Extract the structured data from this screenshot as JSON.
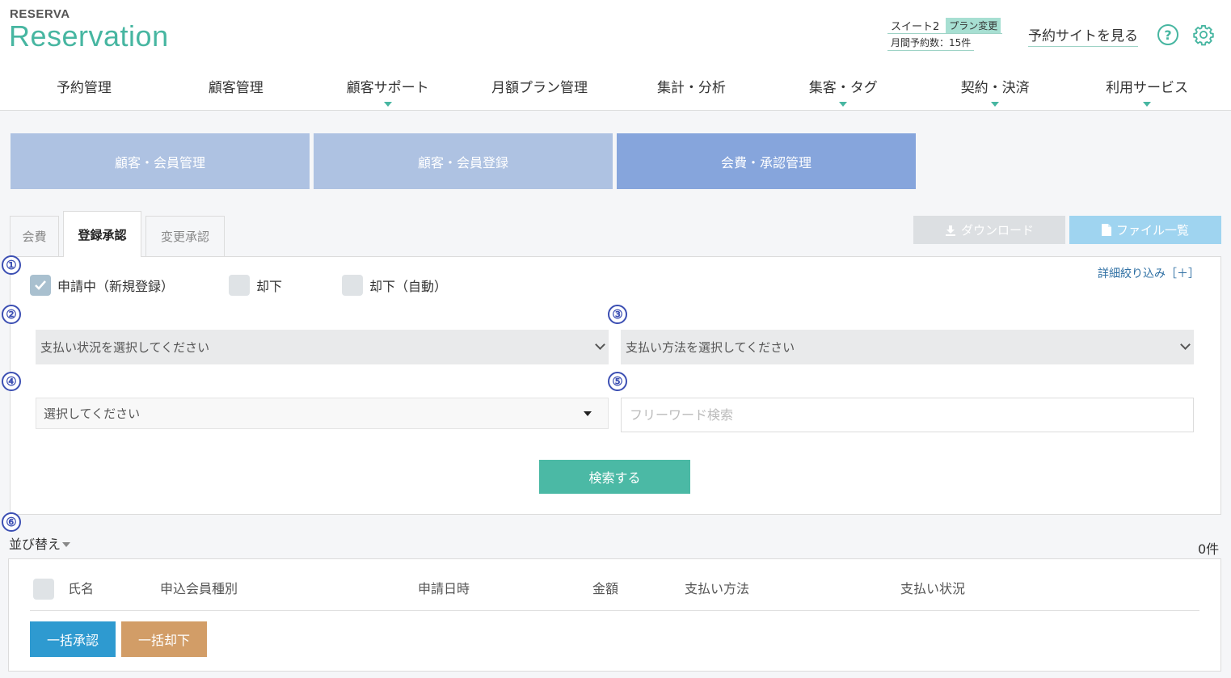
{
  "header": {
    "logo_small": "RESERVA",
    "logo_big": "Reservation",
    "plan_name": "スイート2",
    "plan_change": "プラン変更",
    "monthly_reservations": "月間予約数：15件",
    "view_site": "予約サイトを見る",
    "help_glyph": "?",
    "accent_color": "#47b6a1"
  },
  "nav": [
    {
      "label": "予約管理",
      "has_menu": false
    },
    {
      "label": "顧客管理",
      "has_menu": false
    },
    {
      "label": "顧客サポート",
      "has_menu": true
    },
    {
      "label": "月額プラン管理",
      "has_menu": false
    },
    {
      "label": "集計・分析",
      "has_menu": false
    },
    {
      "label": "集客・タグ",
      "has_menu": true
    },
    {
      "label": "契約・決済",
      "has_menu": true
    },
    {
      "label": "利用サービス",
      "has_menu": true
    }
  ],
  "big_tabs": [
    "顧客・会員管理",
    "顧客・会員登録",
    "会費・承認管理"
  ],
  "sub_tabs": [
    "会費",
    "登録承認",
    "変更承認"
  ],
  "actions": {
    "download": "ダウンロード",
    "file_list": "ファイル一覧"
  },
  "markers": [
    "①",
    "②",
    "③",
    "④",
    "⑤",
    "⑥"
  ],
  "filters": {
    "status_checkboxes": [
      {
        "label": "申請中（新規登録）",
        "checked": true
      },
      {
        "label": "却下",
        "checked": false
      },
      {
        "label": "却下（自動）",
        "checked": false
      }
    ],
    "detail_link": "詳細絞り込み［＋］",
    "payment_status_placeholder": "支払い状況を選択してください",
    "payment_method_placeholder": "支払い方法を選択してください",
    "select_placeholder": "選択してください",
    "free_word_placeholder": "フリーワード検索",
    "search_button": "検索する"
  },
  "list": {
    "sort_label": "並び替え",
    "count": "0件",
    "columns": [
      "氏名",
      "申込会員種別",
      "申請日時",
      "金額",
      "支払い方法",
      "支払い状況"
    ],
    "bulk_approve": "一括承認",
    "bulk_reject": "一括却下"
  }
}
